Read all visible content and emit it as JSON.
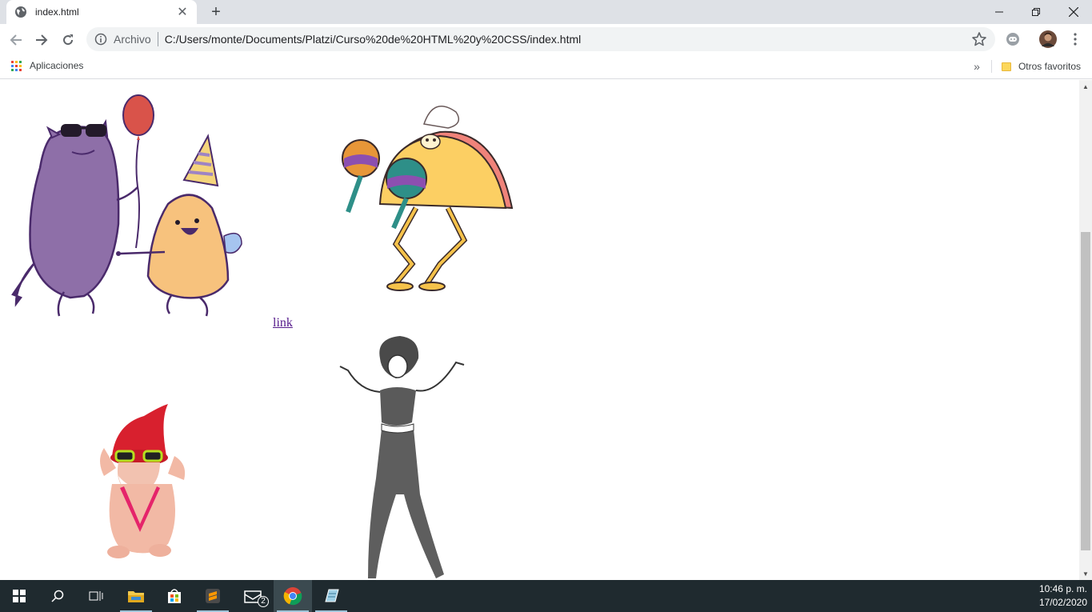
{
  "browser": {
    "tab_title": "index.html",
    "omnibox_chip": "Archivo",
    "url": "C:/Users/monte/Documents/Platzi/Curso%20de%20HTML%20y%20CSS/index.html",
    "bookmarks": {
      "apps_label": "Aplicaciones",
      "more_label": "»",
      "other_label": "Otros favoritos"
    }
  },
  "page": {
    "link_text": "link",
    "images": [
      "monsters-party-gif",
      "taco-maracas-gif",
      "gnome-dancing-gif",
      "woman-dancing-gif"
    ]
  },
  "taskbar": {
    "mail_badge": "2",
    "time": "10:46 p. m.",
    "date": "17/02/2020"
  },
  "colors": {
    "monster_purple": "#8e6fa8",
    "monster_orange": "#f7c27d",
    "taco_yellow": "#fccf63",
    "gnome_red": "#d8202e",
    "chrome_tab_bg": "#dee1e6",
    "taskbar_bg": "#1f2a2f",
    "visited_link": "#551a8b"
  }
}
